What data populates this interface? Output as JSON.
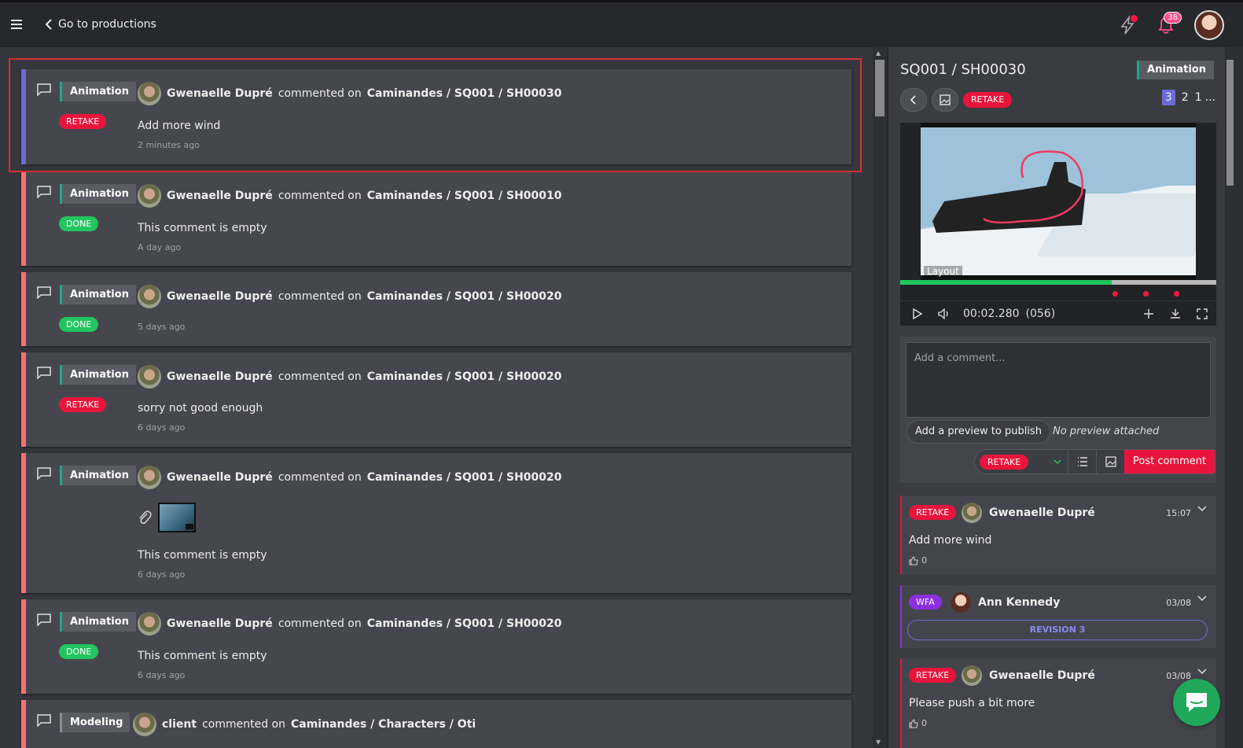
{
  "topbar": {
    "back_label": "Go to productions",
    "notification_count": "38",
    "colors": {
      "alert": "#ff1744",
      "badge": "#ff4d8d"
    }
  },
  "feed": [
    {
      "task": "Animation",
      "status": "RETAKE",
      "author": "Gwenaelle Dupré",
      "verb": "commented on",
      "target": "Caminandes / SQ001 / SH00030",
      "text": "Add more wind",
      "time": "2 minutes ago"
    },
    {
      "task": "Animation",
      "status": "DONE",
      "author": "Gwenaelle Dupré",
      "verb": "commented on",
      "target": "Caminandes / SQ001 / SH00010",
      "text": "This comment is empty",
      "time": "A day ago"
    },
    {
      "task": "Animation",
      "status": "DONE",
      "author": "Gwenaelle Dupré",
      "verb": "commented on",
      "target": "Caminandes / SQ001 / SH00020",
      "text": "",
      "time": "5 days ago"
    },
    {
      "task": "Animation",
      "status": "RETAKE",
      "author": "Gwenaelle Dupré",
      "verb": "commented on",
      "target": "Caminandes / SQ001 / SH00020",
      "text": "sorry not good enough",
      "time": "6 days ago"
    },
    {
      "task": "Animation",
      "status": "",
      "author": "Gwenaelle Dupré",
      "verb": "commented on",
      "target": "Caminandes / SQ001 / SH00020",
      "text": "This comment is empty",
      "time": "6 days ago",
      "attachment": true
    },
    {
      "task": "Animation",
      "status": "DONE",
      "author": "Gwenaelle Dupré",
      "verb": "commented on",
      "target": "Caminandes / SQ001 / SH00020",
      "text": "This comment is empty",
      "time": "6 days ago"
    },
    {
      "task": "Modeling",
      "status": "",
      "author": "client",
      "verb": "commented on",
      "target": "Caminandes / Characters / Oti",
      "text": "",
      "time": ""
    }
  ],
  "panel": {
    "shot_title": "SQ001 / SH00030",
    "task": "Animation",
    "status": "RETAKE",
    "revisions": [
      "3",
      "2",
      "1",
      "..."
    ],
    "player": {
      "frame_label": "Layout",
      "timecode": "00:02.280",
      "frame": "(056)",
      "progress_fraction": 0.67
    },
    "composer": {
      "placeholder": "Add a comment...",
      "add_preview": "Add a preview to publish",
      "no_preview": "No preview attached",
      "status": "RETAKE",
      "post": "Post comment"
    },
    "history": [
      {
        "status": "RETAKE",
        "author": "Gwenaelle Dupré",
        "date": "15:07",
        "text": "Add more wind",
        "likes": "0"
      },
      {
        "status": "WFA",
        "author": "Ann Kennedy",
        "date": "03/08",
        "revision": "REVISION 3"
      },
      {
        "status": "RETAKE",
        "author": "Gwenaelle Dupré",
        "date": "03/08",
        "text": "Please push a bit more",
        "likes": "0"
      }
    ]
  }
}
